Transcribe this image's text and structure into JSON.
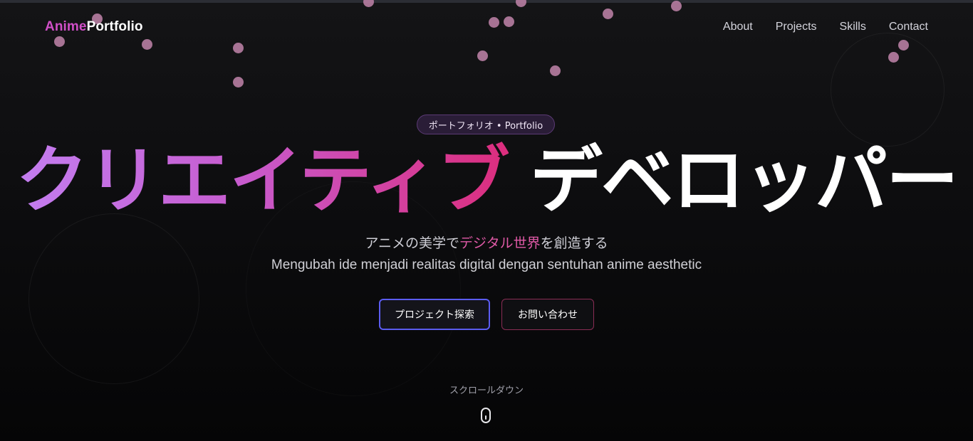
{
  "nav": {
    "logo_part1": "Anime",
    "logo_part2": "Portfolio",
    "links": [
      "About",
      "Projects",
      "Skills",
      "Contact"
    ]
  },
  "hero": {
    "badge": "ポートフォリオ • Portfolio",
    "headline_accent": "クリエイティブ",
    "headline_main": "デベロッパー",
    "subtitle_jp_before": "アニメの美学で",
    "subtitle_jp_accent": "デジタル世界",
    "subtitle_jp_after": "を創造する",
    "subtitle_id": "Mengubah ide menjadi realitas digital dengan sentuhan anime aesthetic",
    "primary_button": "プロジェクト探索",
    "secondary_button": "お問い合わせ",
    "scroll_label": "スクロールダウン"
  },
  "colors": {
    "accent_pink": "#e15aa7",
    "accent_purple": "#c37ef0",
    "primary_button_border": "#5b5cf0",
    "secondary_button_border": "#8a2d55",
    "particle": "#b47ca0"
  },
  "icons": {
    "scroll": "mouse-scroll-icon"
  }
}
